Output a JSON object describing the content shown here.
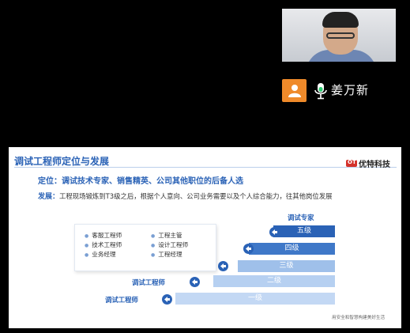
{
  "participant": {
    "name": "姜万新",
    "avatar_color": "#ef8a2a",
    "icons": [
      "person-icon",
      "microphone-icon"
    ]
  },
  "slide": {
    "title": "调试工程师定位与发展",
    "logo_mark": "OT",
    "logo_text": "优特科技",
    "positioning": {
      "key": "定位：",
      "text": "调试技术专家、销售精英、公司其他职位的后备人选"
    },
    "development": {
      "key": "发展：",
      "text": "工程现场锻炼到T3级之后，根据个人意向、公司业务需要以及个人综合能力，往其他岗位发展"
    },
    "roles": [
      "客服工程师",
      "工程主管",
      "技术工程师",
      "设计工程师",
      "业务经理",
      "工程经理"
    ],
    "levels": [
      "五级",
      "四级",
      "三级",
      "二级",
      "一级"
    ],
    "level_labels": {
      "expert": "调试专家",
      "engineer_a": "调试工程师",
      "engineer_b": "调试工程师"
    },
    "slogan": "用安全和智慧构建美好生活",
    "accent_color": "#2a62b6"
  }
}
